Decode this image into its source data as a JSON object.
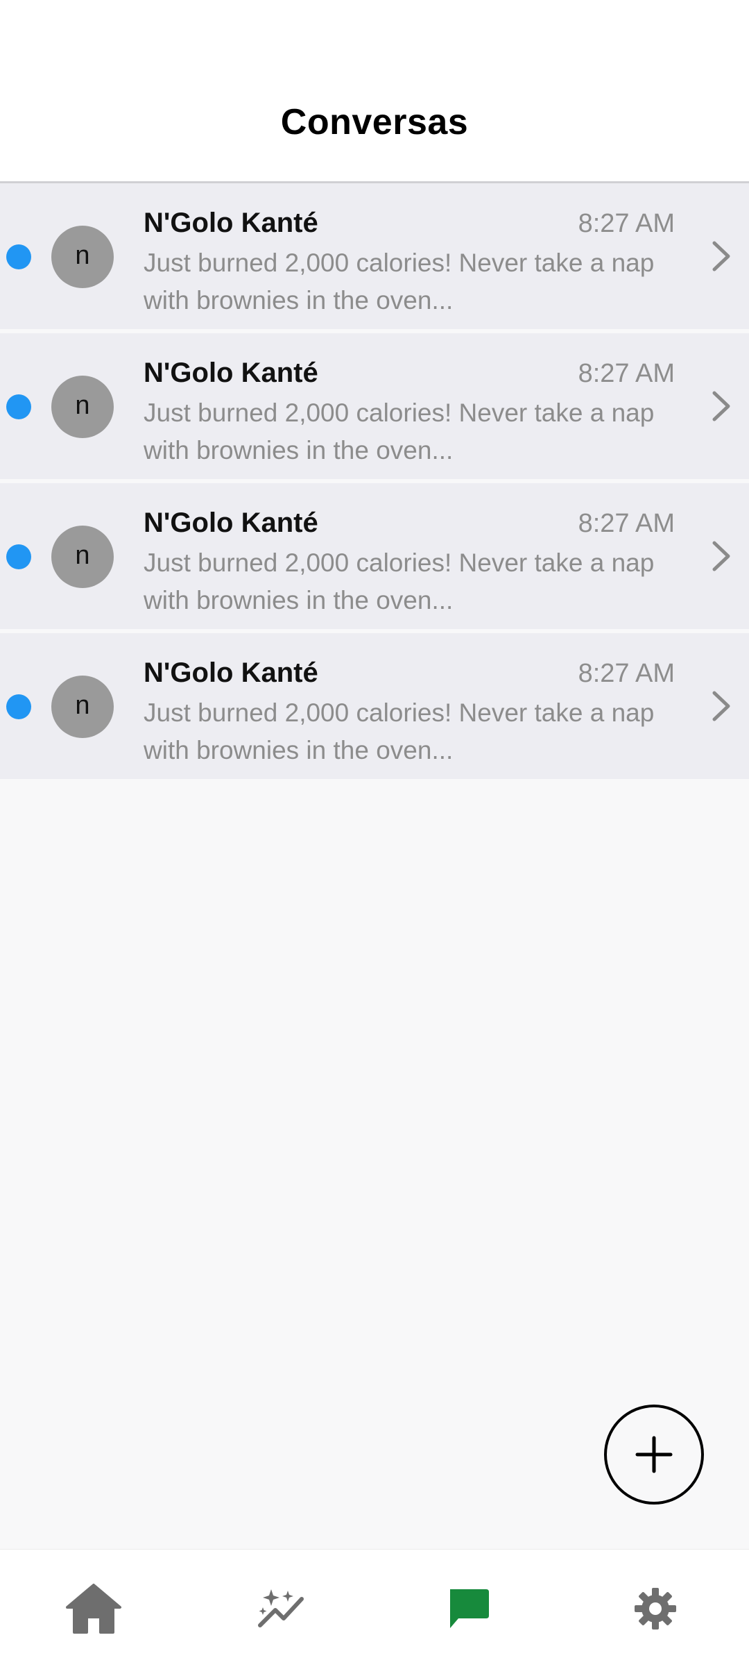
{
  "header": {
    "title": "Conversas"
  },
  "conversations": [
    {
      "avatar_letter": "n",
      "name": "N'Golo Kanté",
      "time": "8:27 AM",
      "preview": "Just burned 2,000 calories! Never take a nap with brownies in the oven...",
      "unread": true
    },
    {
      "avatar_letter": "n",
      "name": "N'Golo Kanté",
      "time": "8:27 AM",
      "preview": "Just burned 2,000 calories! Never take a nap with brownies in the oven...",
      "unread": true
    },
    {
      "avatar_letter": "n",
      "name": "N'Golo Kanté",
      "time": "8:27 AM",
      "preview": "Just burned 2,000 calories! Never take a nap with brownies in the oven...",
      "unread": true
    },
    {
      "avatar_letter": "n",
      "name": "N'Golo Kanté",
      "time": "8:27 AM",
      "preview": "Just burned 2,000 calories! Never take a nap with brownies in the oven...",
      "unread": true
    }
  ],
  "fab": {
    "icon": "plus-icon"
  },
  "bottom_nav": {
    "items": [
      {
        "icon": "home-icon",
        "active": false
      },
      {
        "icon": "sparkles-chart-icon",
        "active": false
      },
      {
        "icon": "chat-icon",
        "active": true
      },
      {
        "icon": "gear-icon",
        "active": false
      }
    ]
  },
  "colors": {
    "unread_dot": "#2196f3",
    "active_nav": "#178a3c",
    "inactive_nav": "#6e6e6e",
    "row_background": "#ededf2",
    "avatar_background": "#9a9a9a"
  }
}
